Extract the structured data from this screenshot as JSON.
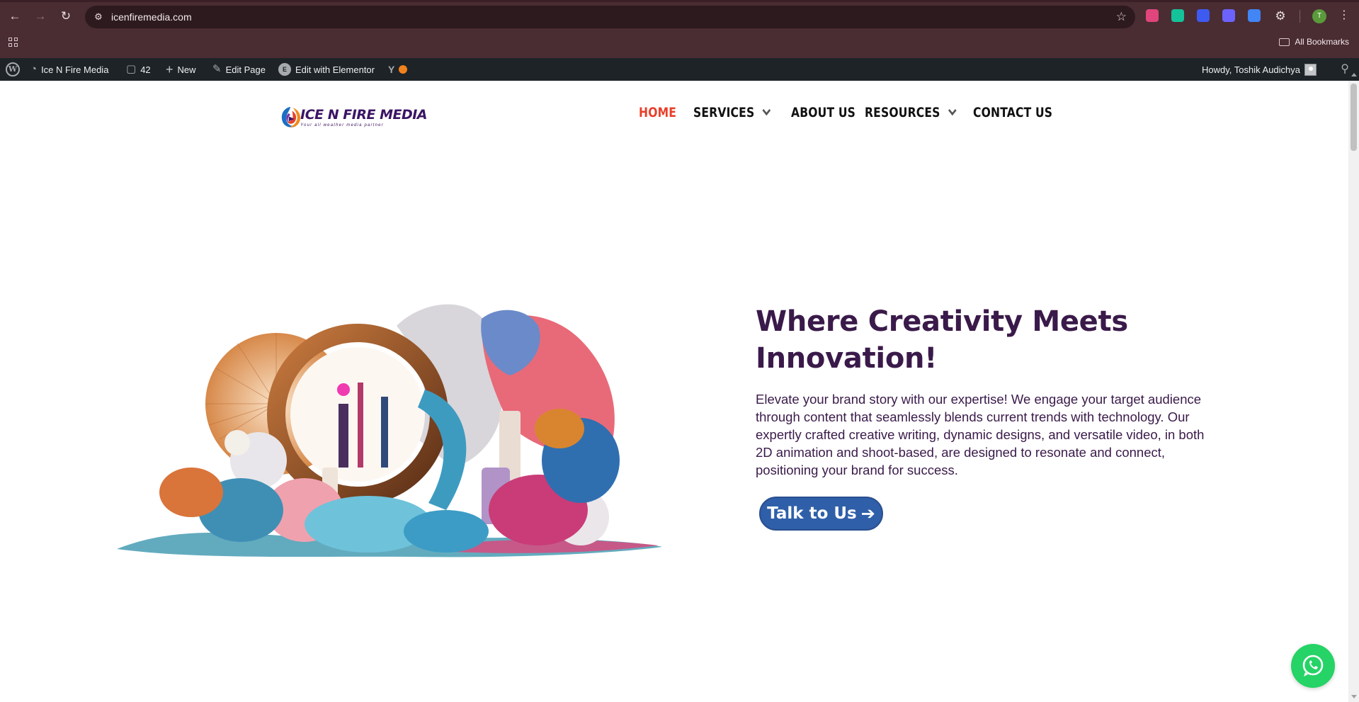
{
  "browser": {
    "url": "icenfiremedia.com",
    "bookmarks_label": "All Bookmarks",
    "profile_initial": "T",
    "extensions": [
      {
        "name": "screen-capture-extension-icon",
        "color": "#e0457b"
      },
      {
        "name": "grammarly-extension-icon",
        "color": "#15c39a"
      },
      {
        "name": "search-extension-icon",
        "color": "#3d5af1"
      },
      {
        "name": "sparkle-extension-icon",
        "color": "#6c63ff"
      },
      {
        "name": "translate-extension-icon",
        "color": "#4285f4"
      }
    ]
  },
  "adminbar": {
    "site_name": "Ice N Fire Media",
    "comments_count": "42",
    "new_label": "New",
    "edit_page_label": "Edit Page",
    "elementor_label": "Edit with Elementor",
    "greeting": "Howdy, Toshik Audichya"
  },
  "site": {
    "logo_title": "ICE N FIRE MEDIA",
    "logo_tagline": "Your all weather media partner",
    "nav": [
      {
        "label": "HOME",
        "active": true,
        "dropdown": false
      },
      {
        "label": "SERVICES",
        "active": false,
        "dropdown": true
      },
      {
        "label": "ABOUT US",
        "active": false,
        "dropdown": false
      },
      {
        "label": "RESOURCES",
        "active": false,
        "dropdown": true
      },
      {
        "label": "CONTACT US",
        "active": false,
        "dropdown": false
      }
    ]
  },
  "hero": {
    "title": "Where Creativity Meets Innovation!",
    "body": "Elevate your brand story with our expertise! We engage your target audience through content that seamlessly blends current trends with technology. Our expertly crafted creative writing, dynamic designs, and versatile video, in both 2D animation and shoot-based, are designed to resonate and connect, positioning your brand for success.",
    "cta_label": "Talk to Us"
  },
  "colors": {
    "accent_active": "#e8402a",
    "heading": "#3a1a4a",
    "cta": "#2f5fa8",
    "whatsapp": "#25d366"
  }
}
